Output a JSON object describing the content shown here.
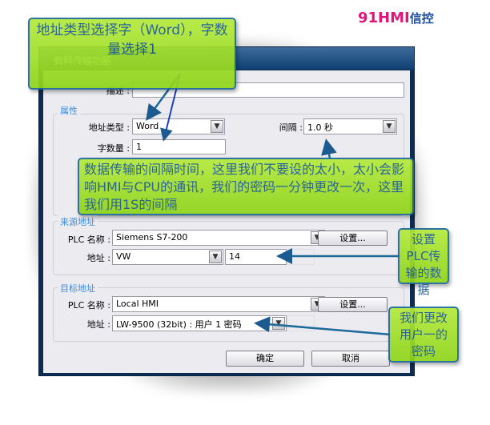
{
  "logo": {
    "brand": "91HMI",
    "suffix": "信控",
    "colors": {
      "91": "#e0157a",
      "HMI": "#1d4fa0",
      "suffix": "#1d4fa0"
    }
  },
  "dialog": {
    "title": "资料传输功能",
    "description": {
      "label": "描述 :",
      "value": ""
    },
    "attributes": {
      "group_title": "属性",
      "address_type": {
        "label": "地址类型 :",
        "value": "Word"
      },
      "interval": {
        "label": "间隔 :",
        "value": "1.0  秒"
      },
      "word_count": {
        "label": "字数量 :",
        "value": "1"
      }
    },
    "source": {
      "group_title": "来源地址",
      "plc_name": {
        "label": "PLC 名称 :",
        "value": "Siemens S7-200"
      },
      "settings_button": "设置...",
      "address": {
        "label": "地址 :",
        "type": "VW",
        "value": "14"
      }
    },
    "target": {
      "group_title": "目标地址",
      "plc_name": {
        "label": "PLC 名称 :",
        "value": "Local HMI"
      },
      "settings_button": "设置...",
      "address": {
        "label": "地址 :",
        "value": "LW-9500 (32bit) : 用户 1 密码"
      }
    },
    "ok_button": "确定",
    "cancel_button": "取消"
  },
  "callouts": {
    "top": "地址类型选择字（Word），字数量选择1",
    "middle": "数据传输的间隔时间，这里我们不要设的太小，太小会影响HMI与CPU的通讯，我们的密码一分钟更改一次，这里我们用1S的间隔",
    "right1": "设置PLC传输的数据",
    "right2": "我们更改用户一的密码"
  },
  "colors": {
    "callout_fill": "#a6e22e",
    "callout_text": "#1c5a92",
    "titlebar": "#0e3f73",
    "group_title": "#3b8de0"
  }
}
